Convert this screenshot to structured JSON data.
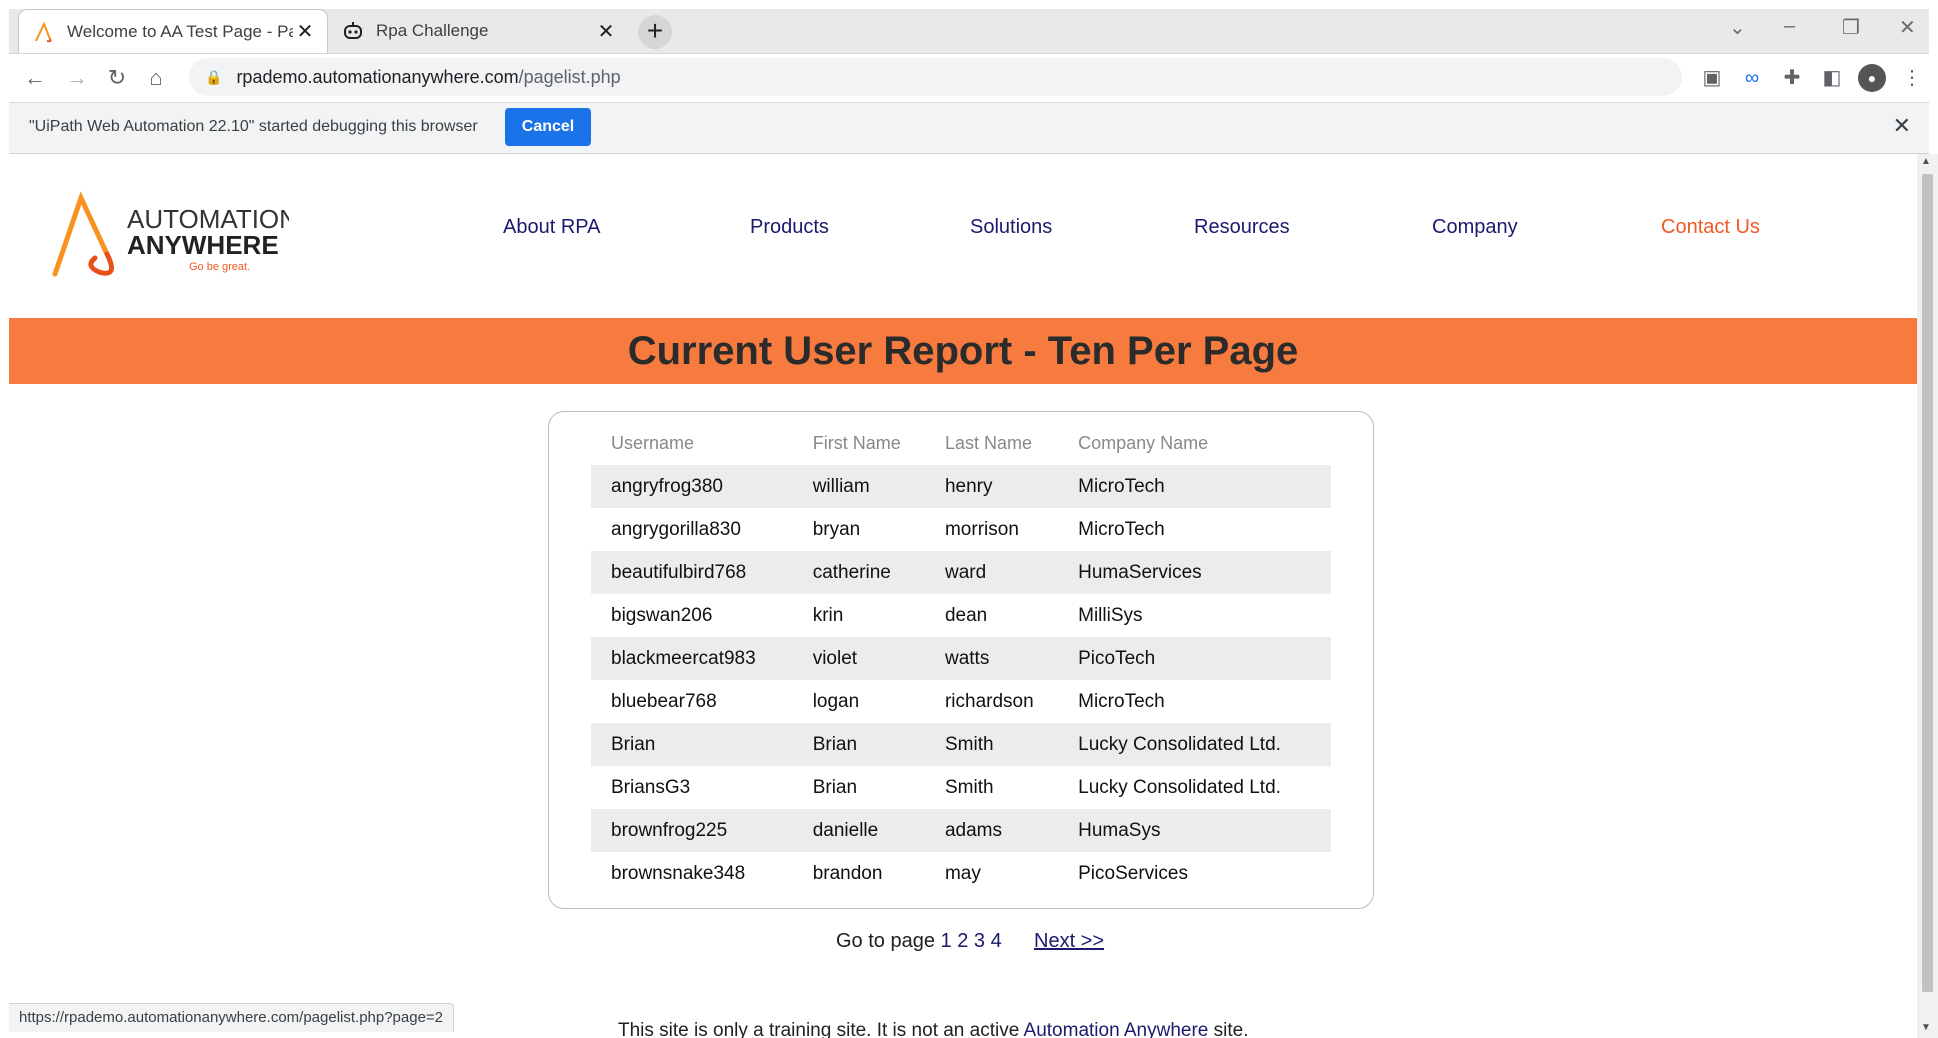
{
  "browser": {
    "tabs": [
      {
        "label": "Welcome to AA Test Page - Page"
      },
      {
        "label": "Rpa Challenge"
      }
    ],
    "tab_close": "✕",
    "new_tab": "+",
    "url_host": "rpademo.automationanywhere.com",
    "url_path": "/pagelist.php",
    "infobar_message": "\"UiPath Web Automation 22.10\" started debugging this browser",
    "infobar_button": "Cancel",
    "status_url": "https://rpademo.automationanywhere.com/pagelist.php?page=2"
  },
  "site": {
    "logo": {
      "line1": "AUTOMATION",
      "line2": "ANYWHERE",
      "tagline": "Go be great."
    },
    "nav": [
      "About RPA",
      "Products",
      "Solutions",
      "Resources",
      "Company",
      "Contact Us"
    ],
    "banner_title": "Current User Report - Ten Per Page",
    "table": {
      "headers": [
        "Username",
        "First Name",
        "Last Name",
        "Company Name"
      ],
      "rows": [
        [
          "angryfrog380",
          "william",
          "henry",
          "MicroTech"
        ],
        [
          "angrygorilla830",
          "bryan",
          "morrison",
          "MicroTech"
        ],
        [
          "beautifulbird768",
          "catherine",
          "ward",
          "HumaServices"
        ],
        [
          "bigswan206",
          "krin",
          "dean",
          "MilliSys"
        ],
        [
          "blackmeercat983",
          "violet",
          "watts",
          "PicoTech"
        ],
        [
          "bluebear768",
          "logan",
          "richardson",
          "MicroTech"
        ],
        [
          "Brian",
          "Brian",
          "Smith",
          "Lucky Consolidated Ltd."
        ],
        [
          "BriansG3",
          "Brian",
          "Smith",
          "Lucky Consolidated Ltd."
        ],
        [
          "brownfrog225",
          "danielle",
          "adams",
          "HumaSys"
        ],
        [
          "brownsnake348",
          "brandon",
          "may",
          "PicoServices"
        ]
      ]
    },
    "pager": {
      "label": "Go to page",
      "pages": [
        "1",
        "2",
        "3",
        "4"
      ],
      "next": "Next >>"
    },
    "footer": {
      "text": "This site is only a training site. It is not an active",
      "link": "Automation Anywhere",
      "suffix": "site."
    }
  },
  "colors": {
    "accent_orange": "#f77b3f",
    "nav_blue": "#1a1a6e",
    "contact_orange": "#f15a22",
    "button_blue": "#1a73e8"
  }
}
